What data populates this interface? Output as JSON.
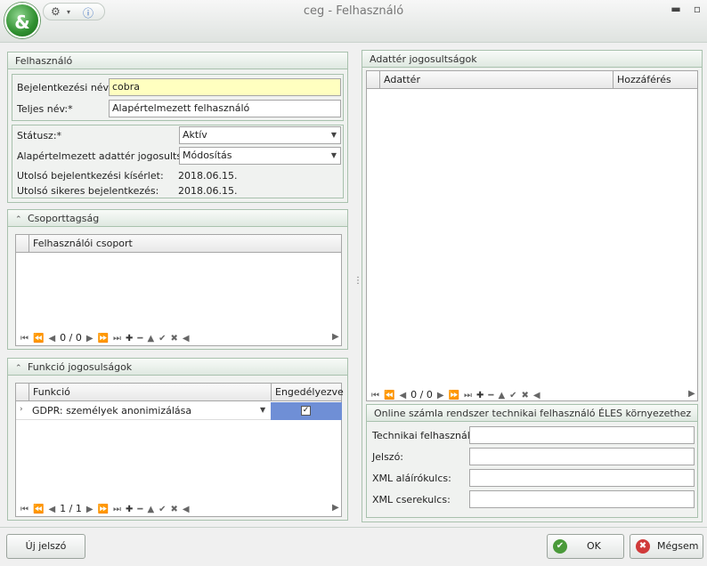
{
  "window": {
    "title": "ceg - Felhasználó",
    "minimize": "▬",
    "maximize": "▫"
  },
  "user_panel": {
    "header": "Felhasználó",
    "login_label": "Bejelentkezési név:*",
    "login_value": "cobra",
    "fullname_label": "Teljes név:*",
    "fullname_value": "Alapértelmezett felhasználó",
    "status_label": "Státusz:*",
    "status_value": "Aktív",
    "default_rights_label": "Alapértelmezett adattér jogosultság:",
    "default_rights_value": "Módosítás",
    "last_attempt_label": "Utolsó bejelentkezési kísérlet:",
    "last_attempt_value": "2018.06.15.",
    "last_success_label": "Utolsó sikeres bejelentkezés:",
    "last_success_value": "2018.06.15."
  },
  "group_panel": {
    "header": "Csoporttagság",
    "column": "Felhasználói csoport",
    "page": "0 / 0"
  },
  "function_panel": {
    "header": "Funkció jogosulságok",
    "col_function": "Funkció",
    "col_allowed": "Engedélyezve",
    "rows": [
      {
        "function": "GDPR: személyek anonimizálása",
        "allowed": true
      }
    ],
    "page": "1 / 1"
  },
  "dataspace_panel": {
    "header": "Adattér jogosultságok",
    "col_dataspace": "Adattér",
    "col_access": "Hozzáférés",
    "page": "0 / 0"
  },
  "online_panel": {
    "header": "Online számla rendszer technikai felhasználó ÉLES környezethez",
    "tech_user_label": "Technikai felhasználó:",
    "password_label": "Jelszó:",
    "xml_sign_label": "XML aláírókulcs:",
    "xml_exchange_label": "XML cserekulcs:"
  },
  "buttons": {
    "new_password": "Új jelszó",
    "ok": "OK",
    "cancel": "Mégsem"
  },
  "icons": {
    "app": "app-logo",
    "settings": "gear-icon",
    "info": "info-icon"
  }
}
